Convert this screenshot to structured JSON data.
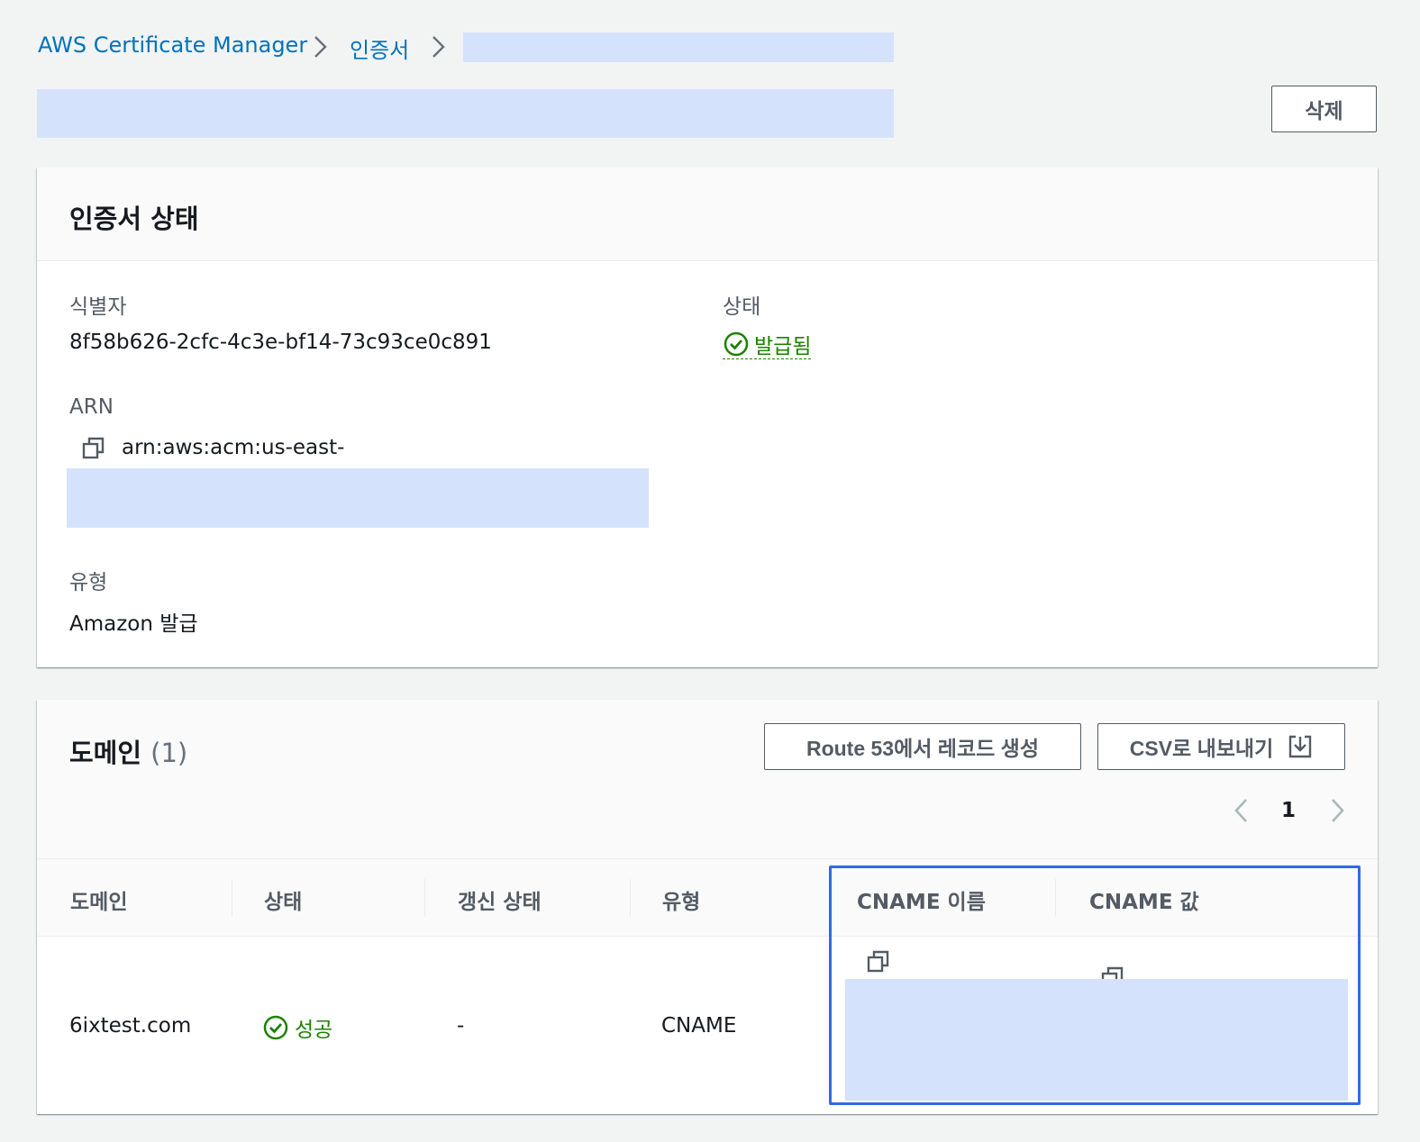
{
  "breadcrumb": {
    "root": "AWS Certificate Manager",
    "certificates": "인증서"
  },
  "header": {
    "delete_label": "삭제"
  },
  "cert_status": {
    "title": "인증서 상태",
    "identifier_label": "식별자",
    "identifier_value": "8f58b626-2cfc-4c3e-bf14-73c93ce0c891",
    "status_label": "상태",
    "status_value": "발급됨",
    "arn_label": "ARN",
    "arn_value": "arn:aws:acm:us-east-",
    "type_label": "유형",
    "type_value": "Amazon 발급"
  },
  "domains": {
    "title": "도메인",
    "count": "(1)",
    "route53_label": "Route 53에서 레코드 생성",
    "csv_label": "CSV로 내보내기",
    "page": "1",
    "columns": [
      "도메인",
      "상태",
      "갱신 상태",
      "유형",
      "CNAME 이름",
      "CNAME 값"
    ],
    "rows": [
      {
        "domain": "6ixtest.com",
        "status": "성공",
        "renewal": "-",
        "type": "CNAME"
      }
    ]
  },
  "colors": {
    "link": "#0073bb",
    "success": "#1d8102",
    "highlight": "#2f6ae6",
    "redaction": "#d5e2fb"
  }
}
